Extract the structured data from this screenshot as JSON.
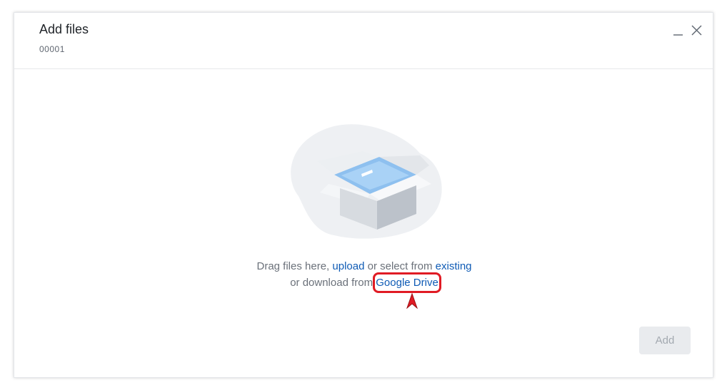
{
  "dialog": {
    "title": "Add files",
    "subtitle": "00001",
    "minimize_icon": "minimize-icon",
    "close_icon": "close-icon"
  },
  "dropzone": {
    "illustration_icon": "open-box-icon",
    "line1_prefix": "Drag files here, ",
    "upload_link": "upload",
    "line1_middle": " or select from ",
    "existing_link": "existing",
    "line2_prefix": "or download from ",
    "google_drive_link": "Google Drive",
    "highlight_color": "#e01b24"
  },
  "footer": {
    "add_label": "Add"
  },
  "colors": {
    "link": "#0f5bb5",
    "text_muted": "#6b717a",
    "button_disabled_bg": "#e9ebee",
    "button_disabled_text": "#a3a9b0"
  }
}
